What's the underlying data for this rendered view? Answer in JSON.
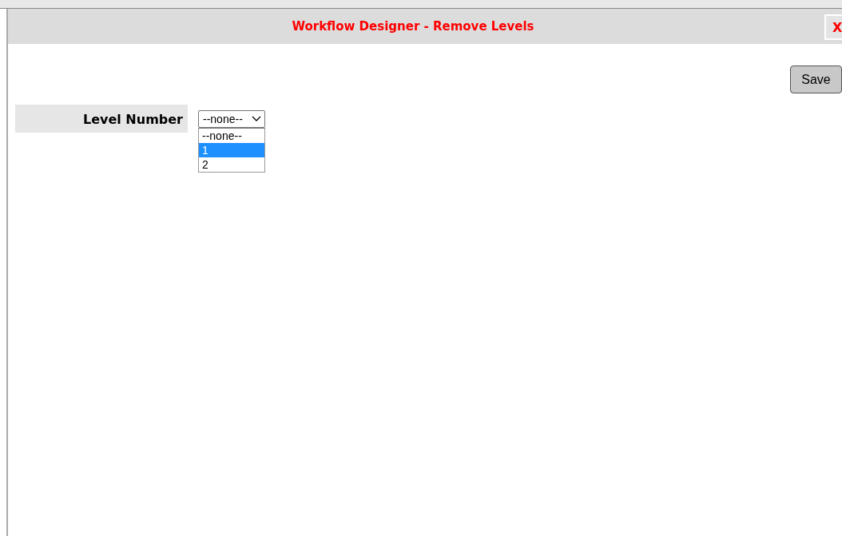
{
  "dialog": {
    "title": "Workflow Designer - Remove Levels",
    "close": "X"
  },
  "save_button": "Save",
  "field": {
    "label": "Level Number",
    "value": "--none--",
    "options": [
      {
        "label": "--none--",
        "highlighted": false
      },
      {
        "label": "1",
        "highlighted": true
      },
      {
        "label": "2",
        "highlighted": false
      }
    ]
  }
}
